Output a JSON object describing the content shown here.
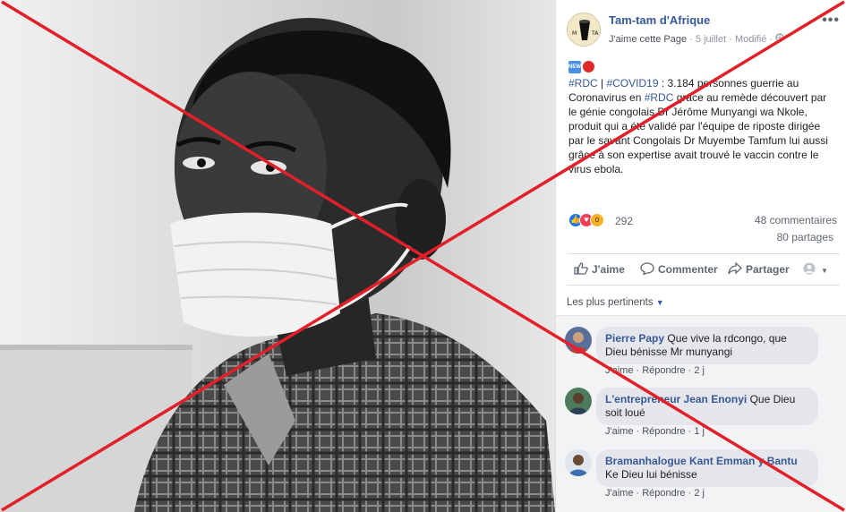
{
  "post": {
    "page_name": "Tam-tam d'Afrique",
    "like_page": "J'aime cette Page",
    "sep": "·",
    "date": "5 juillet",
    "edited": "Modifié",
    "more": "•••",
    "text_tag1": "#RDC",
    "text_sep": " | ",
    "text_tag2": "#COVID19",
    "text_part1": " : 3.184 personnes guerrie au Coronavirus en ",
    "text_tag3": "#RDC",
    "text_part2": " grâce au remède découvert par le génie congolais Dr Jérôme Munyangi wa Nkole, produit qui a été validé par l'équipe de riposte dirigée par le savant Congolais Dr Muyembe Tamfum lui aussi grâce à son expertise avait trouvé le vaccin contre le virus ebola.",
    "reaction_count": "292",
    "comments_count": "48 commentaires",
    "shares_count": "80 partages"
  },
  "actions": {
    "like": "J'aime",
    "comment": "Commenter",
    "share": "Partager"
  },
  "comments_sort": "Les plus pertinents",
  "comments": [
    {
      "author": "Pierre Papy",
      "text": "Que vive la rdcongo, que Dieu bénisse Mr munyangi",
      "like": "J'aime",
      "reply": "Répondre",
      "time": "2 j"
    },
    {
      "author": "L'entrepreneur Jean Enonyi",
      "text": "Que Dieu soit loué",
      "like": "J'aime",
      "reply": "Répondre",
      "time": "1 j"
    },
    {
      "author": "Bramanhalogue Kant Emman y Bantu",
      "text": "Ke Dieu lui bénisse",
      "like": "J'aime",
      "reply": "Répondre",
      "time": "2 j"
    }
  ],
  "colors": {
    "overlay_x": "#e2202a",
    "link_blue": "#365899",
    "facebook_blue": "#1877f2"
  },
  "icons": [
    "like-icon",
    "comment-icon",
    "share-icon",
    "profile-icon",
    "chevron-down-icon"
  ]
}
